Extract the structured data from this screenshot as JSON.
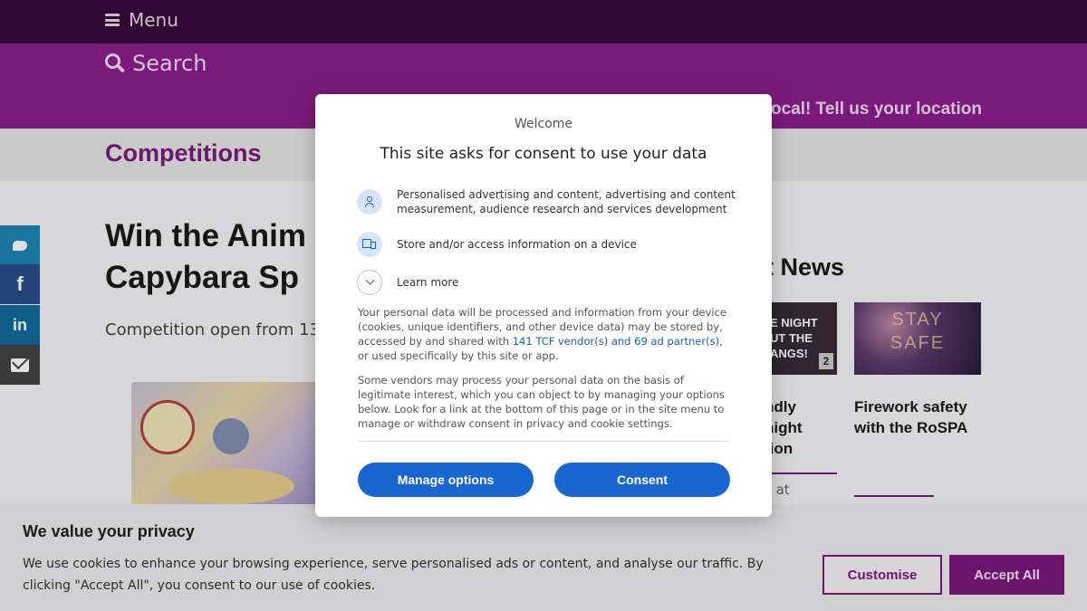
{
  "header": {
    "menu_label": "Menu",
    "search_label": "Search",
    "location_prompt": "ocal! Tell us your location"
  },
  "breadcrumb": {
    "section": "Competitions"
  },
  "share": {
    "icons": [
      "twitter-icon",
      "facebook-icon",
      "linkedin-icon",
      "email-icon"
    ],
    "facebook_glyph": "f",
    "linkedin_glyph": "in"
  },
  "article": {
    "title_line1": "Win the Anim",
    "title_line2": "Capybara Sp",
    "subtitle": "Competition open from 13"
  },
  "latest_news": {
    "heading": "t News",
    "items": [
      {
        "thumb_text": "E NIGHT\nUT THE\nANGS!",
        "badge": "2",
        "title_line1": "ndly",
        "title_line2": "night",
        "title_line3": "tion",
        "meta": "s at"
      },
      {
        "thumb_text": "STAY\nSAFE",
        "title": "Firework safety with the RoSPA"
      }
    ]
  },
  "cookie_bar": {
    "title": "We value your privacy",
    "text": "We use cookies to enhance your browsing experience, serve personalised ads or content, and analyse our traffic. By clicking \"Accept All\", you consent to our use of cookies.",
    "customise_label": "Customise",
    "accept_label": "Accept All",
    "accent_color": "#7a1a7c"
  },
  "consent_dialog": {
    "welcome": "Welcome",
    "heading": "This site asks for consent to use your data",
    "purposes": [
      {
        "icon": "person-icon",
        "text": "Personalised advertising and content, advertising and content measurement, audience research and services development"
      },
      {
        "icon": "device-icon",
        "text": "Store and/or access information on a device"
      }
    ],
    "learn_more": "Learn more",
    "para1_before": "Your personal data will be processed and information from your device (cookies, unique identifiers, and other device data) may be stored by, accessed by and shared with ",
    "para1_link": "141 TCF vendor(s) and 69 ad partner(s)",
    "para1_after": ", or used specifically by this site or app.",
    "para2": "Some vendors may process your personal data on the basis of legitimate interest, which you can object to by managing your options below. Look for a link at the bottom of this page or in the site menu to manage or withdraw consent in privacy and cookie settings.",
    "manage_label": "Manage options",
    "consent_label": "Consent",
    "button_color": "#1a66d0"
  }
}
